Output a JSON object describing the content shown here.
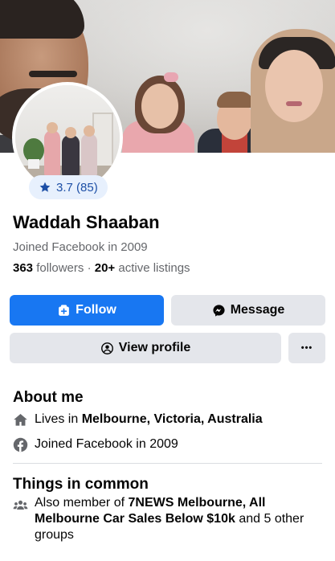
{
  "profile": {
    "name": "Waddah Shaaban",
    "joined": "Joined Facebook in 2009",
    "followers_count": "363",
    "followers_label": "followers",
    "separator": "·",
    "listings_count": "20+",
    "listings_label": "active listings"
  },
  "rating": {
    "value": "3.7 (85)",
    "icon": "star-icon"
  },
  "actions": {
    "follow": "Follow",
    "message": "Message",
    "view_profile": "View profile",
    "more": "•••"
  },
  "about": {
    "heading": "About me",
    "lives_prefix": "Lives in",
    "lives_location": "Melbourne, Victoria, Australia",
    "joined": "Joined Facebook in 2009"
  },
  "common": {
    "heading": "Things in common",
    "prefix": "Also member of",
    "groups": "7NEWS Melbourne, All Melbourne Car Sales Below $10k",
    "suffix": "and 5 other groups"
  },
  "colors": {
    "accent": "#1877f2",
    "rating_bg": "#e7f0fd",
    "rating_text": "#1d4fa6",
    "secondary_button": "#e4e6eb"
  }
}
